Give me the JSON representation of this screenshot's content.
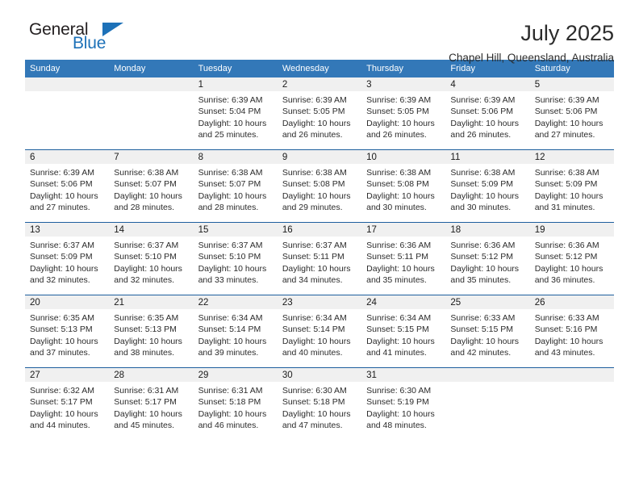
{
  "brand": {
    "name_line1": "General",
    "name_line2": "Blue",
    "accent_color": "#1d71b8"
  },
  "header": {
    "title": "July 2025",
    "subtitle": "Chapel Hill, Queensland, Australia"
  },
  "theme": {
    "header_row_bg": "#3378b8",
    "week_divider": "#1e5f9e",
    "daynum_bg": "#f0f0f0"
  },
  "weekday_headers": [
    "Sunday",
    "Monday",
    "Tuesday",
    "Wednesday",
    "Thursday",
    "Friday",
    "Saturday"
  ],
  "weeks": [
    [
      {
        "day": "",
        "sunrise": "",
        "sunset": "",
        "daylight": "",
        "daylight2": ""
      },
      {
        "day": "",
        "sunrise": "",
        "sunset": "",
        "daylight": "",
        "daylight2": ""
      },
      {
        "day": "1",
        "sunrise": "Sunrise: 6:39 AM",
        "sunset": "Sunset: 5:04 PM",
        "daylight": "Daylight: 10 hours",
        "daylight2": "and 25 minutes."
      },
      {
        "day": "2",
        "sunrise": "Sunrise: 6:39 AM",
        "sunset": "Sunset: 5:05 PM",
        "daylight": "Daylight: 10 hours",
        "daylight2": "and 26 minutes."
      },
      {
        "day": "3",
        "sunrise": "Sunrise: 6:39 AM",
        "sunset": "Sunset: 5:05 PM",
        "daylight": "Daylight: 10 hours",
        "daylight2": "and 26 minutes."
      },
      {
        "day": "4",
        "sunrise": "Sunrise: 6:39 AM",
        "sunset": "Sunset: 5:06 PM",
        "daylight": "Daylight: 10 hours",
        "daylight2": "and 26 minutes."
      },
      {
        "day": "5",
        "sunrise": "Sunrise: 6:39 AM",
        "sunset": "Sunset: 5:06 PM",
        "daylight": "Daylight: 10 hours",
        "daylight2": "and 27 minutes."
      }
    ],
    [
      {
        "day": "6",
        "sunrise": "Sunrise: 6:39 AM",
        "sunset": "Sunset: 5:06 PM",
        "daylight": "Daylight: 10 hours",
        "daylight2": "and 27 minutes."
      },
      {
        "day": "7",
        "sunrise": "Sunrise: 6:38 AM",
        "sunset": "Sunset: 5:07 PM",
        "daylight": "Daylight: 10 hours",
        "daylight2": "and 28 minutes."
      },
      {
        "day": "8",
        "sunrise": "Sunrise: 6:38 AM",
        "sunset": "Sunset: 5:07 PM",
        "daylight": "Daylight: 10 hours",
        "daylight2": "and 28 minutes."
      },
      {
        "day": "9",
        "sunrise": "Sunrise: 6:38 AM",
        "sunset": "Sunset: 5:08 PM",
        "daylight": "Daylight: 10 hours",
        "daylight2": "and 29 minutes."
      },
      {
        "day": "10",
        "sunrise": "Sunrise: 6:38 AM",
        "sunset": "Sunset: 5:08 PM",
        "daylight": "Daylight: 10 hours",
        "daylight2": "and 30 minutes."
      },
      {
        "day": "11",
        "sunrise": "Sunrise: 6:38 AM",
        "sunset": "Sunset: 5:09 PM",
        "daylight": "Daylight: 10 hours",
        "daylight2": "and 30 minutes."
      },
      {
        "day": "12",
        "sunrise": "Sunrise: 6:38 AM",
        "sunset": "Sunset: 5:09 PM",
        "daylight": "Daylight: 10 hours",
        "daylight2": "and 31 minutes."
      }
    ],
    [
      {
        "day": "13",
        "sunrise": "Sunrise: 6:37 AM",
        "sunset": "Sunset: 5:09 PM",
        "daylight": "Daylight: 10 hours",
        "daylight2": "and 32 minutes."
      },
      {
        "day": "14",
        "sunrise": "Sunrise: 6:37 AM",
        "sunset": "Sunset: 5:10 PM",
        "daylight": "Daylight: 10 hours",
        "daylight2": "and 32 minutes."
      },
      {
        "day": "15",
        "sunrise": "Sunrise: 6:37 AM",
        "sunset": "Sunset: 5:10 PM",
        "daylight": "Daylight: 10 hours",
        "daylight2": "and 33 minutes."
      },
      {
        "day": "16",
        "sunrise": "Sunrise: 6:37 AM",
        "sunset": "Sunset: 5:11 PM",
        "daylight": "Daylight: 10 hours",
        "daylight2": "and 34 minutes."
      },
      {
        "day": "17",
        "sunrise": "Sunrise: 6:36 AM",
        "sunset": "Sunset: 5:11 PM",
        "daylight": "Daylight: 10 hours",
        "daylight2": "and 35 minutes."
      },
      {
        "day": "18",
        "sunrise": "Sunrise: 6:36 AM",
        "sunset": "Sunset: 5:12 PM",
        "daylight": "Daylight: 10 hours",
        "daylight2": "and 35 minutes."
      },
      {
        "day": "19",
        "sunrise": "Sunrise: 6:36 AM",
        "sunset": "Sunset: 5:12 PM",
        "daylight": "Daylight: 10 hours",
        "daylight2": "and 36 minutes."
      }
    ],
    [
      {
        "day": "20",
        "sunrise": "Sunrise: 6:35 AM",
        "sunset": "Sunset: 5:13 PM",
        "daylight": "Daylight: 10 hours",
        "daylight2": "and 37 minutes."
      },
      {
        "day": "21",
        "sunrise": "Sunrise: 6:35 AM",
        "sunset": "Sunset: 5:13 PM",
        "daylight": "Daylight: 10 hours",
        "daylight2": "and 38 minutes."
      },
      {
        "day": "22",
        "sunrise": "Sunrise: 6:34 AM",
        "sunset": "Sunset: 5:14 PM",
        "daylight": "Daylight: 10 hours",
        "daylight2": "and 39 minutes."
      },
      {
        "day": "23",
        "sunrise": "Sunrise: 6:34 AM",
        "sunset": "Sunset: 5:14 PM",
        "daylight": "Daylight: 10 hours",
        "daylight2": "and 40 minutes."
      },
      {
        "day": "24",
        "sunrise": "Sunrise: 6:34 AM",
        "sunset": "Sunset: 5:15 PM",
        "daylight": "Daylight: 10 hours",
        "daylight2": "and 41 minutes."
      },
      {
        "day": "25",
        "sunrise": "Sunrise: 6:33 AM",
        "sunset": "Sunset: 5:15 PM",
        "daylight": "Daylight: 10 hours",
        "daylight2": "and 42 minutes."
      },
      {
        "day": "26",
        "sunrise": "Sunrise: 6:33 AM",
        "sunset": "Sunset: 5:16 PM",
        "daylight": "Daylight: 10 hours",
        "daylight2": "and 43 minutes."
      }
    ],
    [
      {
        "day": "27",
        "sunrise": "Sunrise: 6:32 AM",
        "sunset": "Sunset: 5:17 PM",
        "daylight": "Daylight: 10 hours",
        "daylight2": "and 44 minutes."
      },
      {
        "day": "28",
        "sunrise": "Sunrise: 6:31 AM",
        "sunset": "Sunset: 5:17 PM",
        "daylight": "Daylight: 10 hours",
        "daylight2": "and 45 minutes."
      },
      {
        "day": "29",
        "sunrise": "Sunrise: 6:31 AM",
        "sunset": "Sunset: 5:18 PM",
        "daylight": "Daylight: 10 hours",
        "daylight2": "and 46 minutes."
      },
      {
        "day": "30",
        "sunrise": "Sunrise: 6:30 AM",
        "sunset": "Sunset: 5:18 PM",
        "daylight": "Daylight: 10 hours",
        "daylight2": "and 47 minutes."
      },
      {
        "day": "31",
        "sunrise": "Sunrise: 6:30 AM",
        "sunset": "Sunset: 5:19 PM",
        "daylight": "Daylight: 10 hours",
        "daylight2": "and 48 minutes."
      },
      {
        "day": "",
        "sunrise": "",
        "sunset": "",
        "daylight": "",
        "daylight2": ""
      },
      {
        "day": "",
        "sunrise": "",
        "sunset": "",
        "daylight": "",
        "daylight2": ""
      }
    ]
  ]
}
